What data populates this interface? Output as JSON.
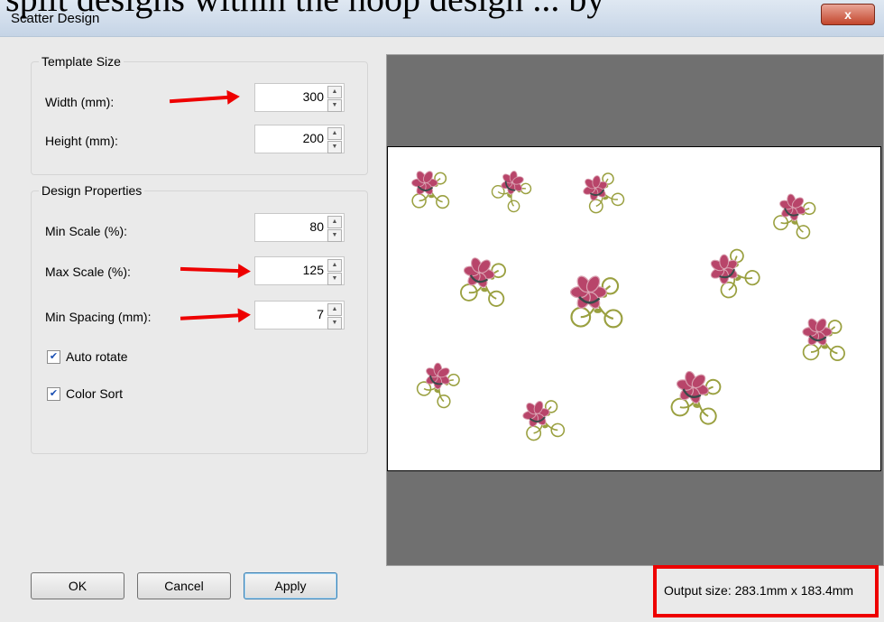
{
  "header": {
    "cutoff_text": "split designs within the hoop design ... by",
    "title": "Scatter Design",
    "close_label": "x"
  },
  "template_size": {
    "legend": "Template Size",
    "width_label": "Width (mm):",
    "width_value": "300",
    "height_label": "Height (mm):",
    "height_value": "200"
  },
  "design_properties": {
    "legend": "Design Properties",
    "min_scale_label": "Min Scale (%):",
    "min_scale_value": "80",
    "max_scale_label": "Max Scale (%):",
    "max_scale_value": "125",
    "min_spacing_label": "Min Spacing (mm):",
    "min_spacing_value": "7",
    "auto_rotate_label": "Auto rotate",
    "auto_rotate_checked": true,
    "color_sort_label": "Color Sort",
    "color_sort_checked": true
  },
  "buttons": {
    "ok": "OK",
    "cancel": "Cancel",
    "apply": "Apply"
  },
  "output_size": "Output size: 283.1mm x 183.4mm",
  "colors": {
    "flower_petal": "#b8456a",
    "flower_outline": "#d9a0b0",
    "flower_center": "#3a4a4a",
    "vine": "#9aa040",
    "preview_bg": "#707070",
    "annotation": "#e00000"
  }
}
